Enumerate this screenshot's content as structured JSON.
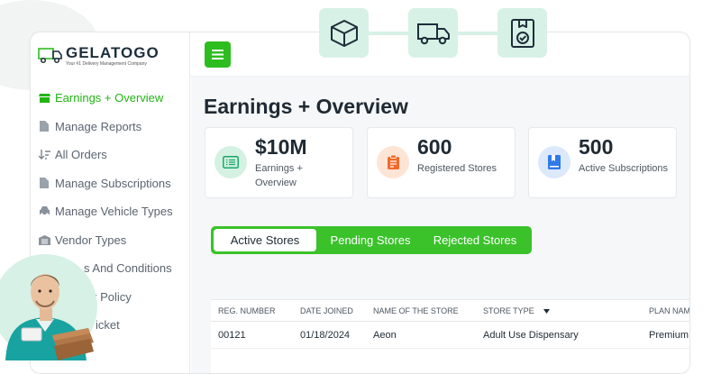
{
  "app": {
    "logo_name": "GELATOGO",
    "logo_sub": "Your #1 Delivery Management Company",
    "menu_icon": "hamburger-icon"
  },
  "sidebar": {
    "items": [
      {
        "label": "Earnings + Overview",
        "icon": "store-icon",
        "active": true
      },
      {
        "label": "Manage Reports",
        "icon": "document-icon",
        "active": false
      },
      {
        "label": "All Orders",
        "icon": "sort-icon",
        "active": false
      },
      {
        "label": "Manage Subscriptions",
        "icon": "document-icon",
        "active": false
      },
      {
        "label": "Manage Vehicle Types",
        "icon": "car-icon",
        "active": false
      },
      {
        "label": "Vendor Types",
        "icon": "garage-icon",
        "active": false
      },
      {
        "label": "s And Conditions",
        "icon": "",
        "active": false
      },
      {
        "label": "y Policy",
        "icon": "",
        "active": false
      },
      {
        "label": "icket",
        "icon": "",
        "active": false
      }
    ]
  },
  "page": {
    "title": "Earnings + Overview"
  },
  "stats": [
    {
      "value": "$10M",
      "label": "Earnings + Overview",
      "icon": "list-icon",
      "color": "#d4f1e2"
    },
    {
      "value": "600",
      "label": "Registered Stores",
      "icon": "clipboard-icon",
      "color": "#fde5d6"
    },
    {
      "value": "500",
      "label": "Active Subscriptions",
      "icon": "bookmark-book-icon",
      "color": "#dce9fb"
    }
  ],
  "tabs": [
    {
      "label": "Active Stores",
      "active": true
    },
    {
      "label": "Pending Stores",
      "active": false
    },
    {
      "label": "Rejected Stores",
      "active": false
    }
  ],
  "table": {
    "columns": [
      "REG. NUMBER",
      "DATE JOINED",
      "NAME OF THE STORE",
      "STORE TYPE",
      "PLAN NAM"
    ],
    "rows": [
      [
        "00121",
        "01/18/2024",
        "Aeon",
        "Adult Use Dispensary",
        "Premium"
      ]
    ]
  },
  "badges": [
    "box-icon",
    "delivery-truck-icon",
    "package-check-icon"
  ],
  "colors": {
    "accent": "#2ebd1f",
    "text": "#1f2a33",
    "badge_bg": "#d7f1e6"
  }
}
